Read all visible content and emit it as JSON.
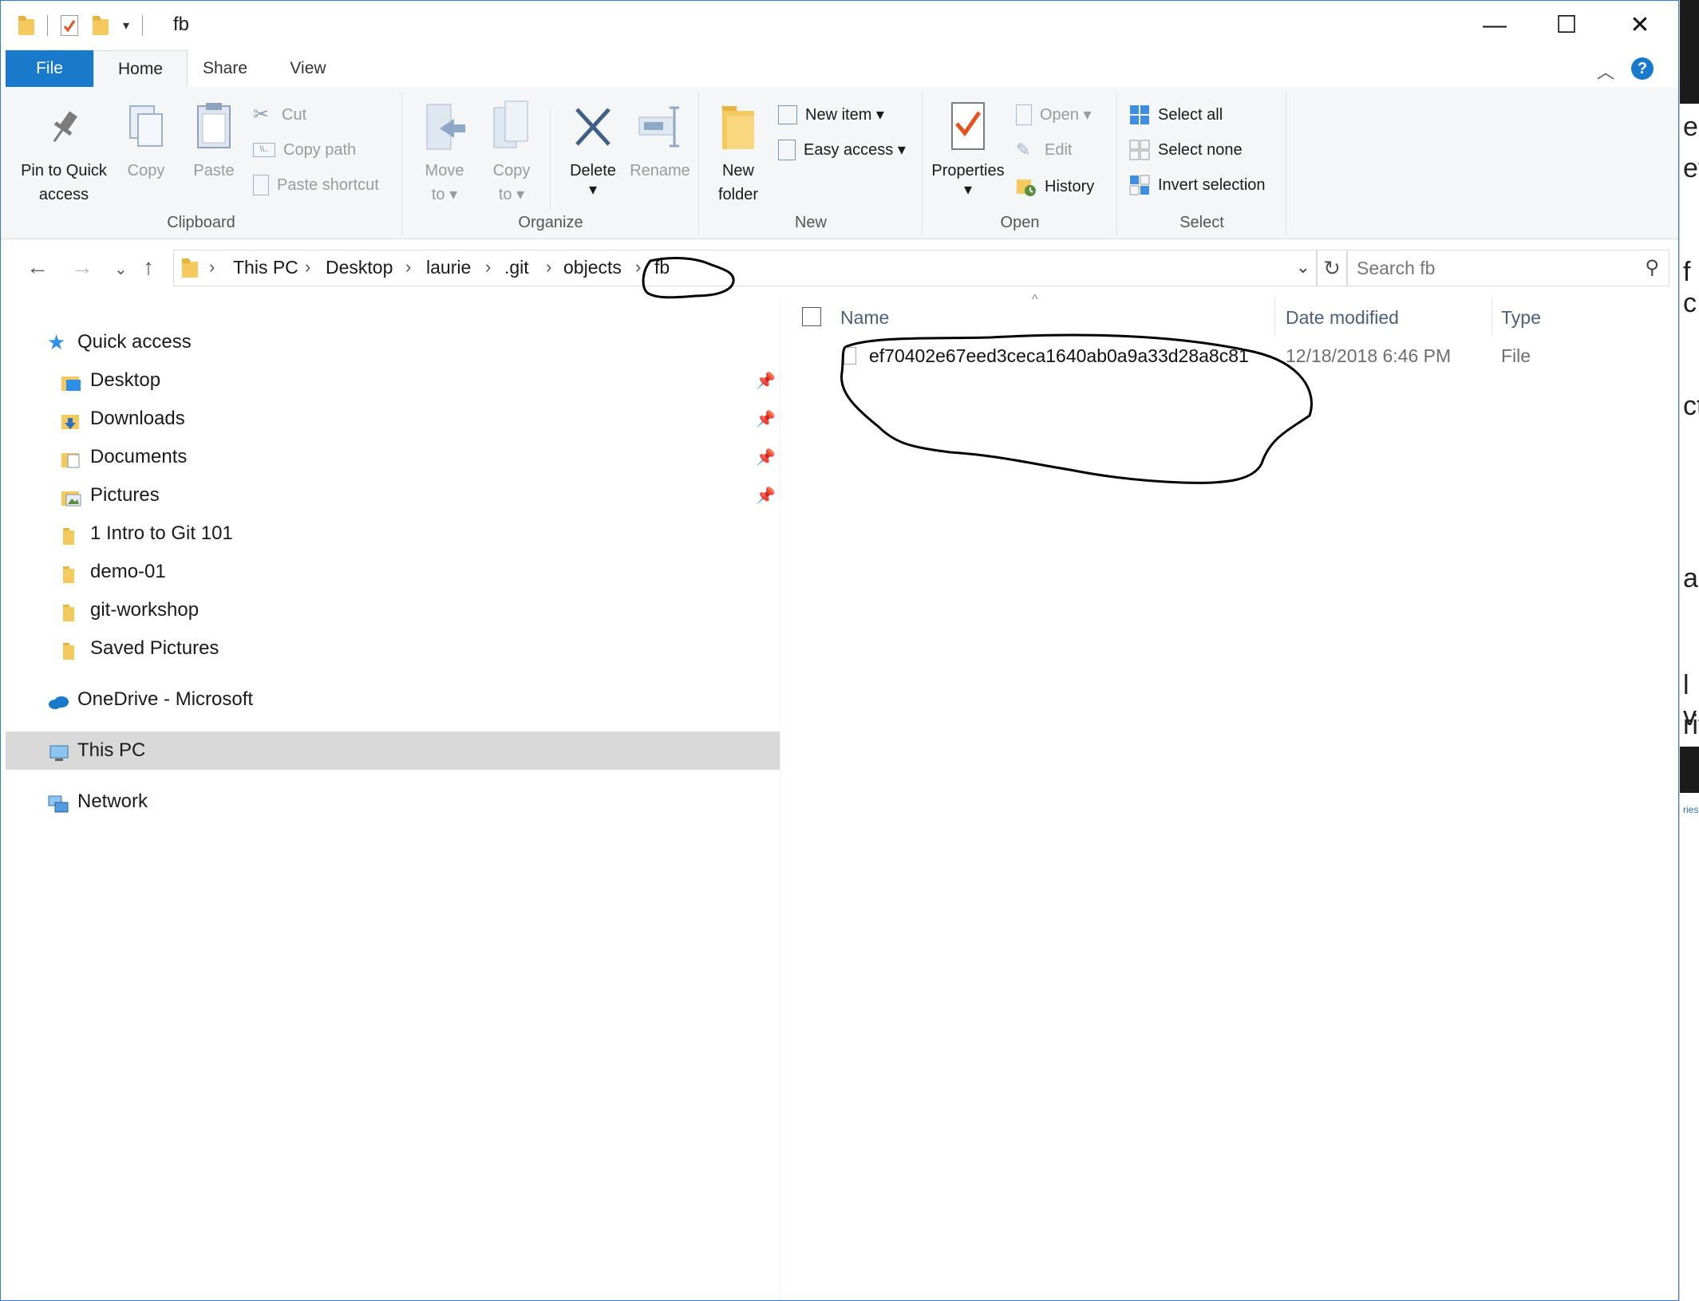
{
  "window": {
    "title": "fb",
    "controls": {
      "minimize": "—",
      "maximize": "☐",
      "close": "✕"
    }
  },
  "tabs": [
    {
      "label": "File"
    },
    {
      "label": "Home"
    },
    {
      "label": "Share"
    },
    {
      "label": "View"
    }
  ],
  "ribbon": {
    "clipboard": {
      "label": "Clipboard",
      "pin_line1": "Pin to Quick",
      "pin_line2": "access",
      "copy": "Copy",
      "paste": "Paste",
      "cut": "Cut",
      "copy_path": "Copy path",
      "paste_shortcut": "Paste shortcut"
    },
    "organize": {
      "label": "Organize",
      "move_line1": "Move",
      "move_line2": "to ▾",
      "copyto_line1": "Copy",
      "copyto_line2": "to ▾",
      "delete": "Delete",
      "delete_arrow": "▾",
      "rename": "Rename"
    },
    "new": {
      "label": "New",
      "new_folder_line1": "New",
      "new_folder_line2": "folder",
      "new_item": "New item ▾",
      "easy_access": "Easy access ▾"
    },
    "open": {
      "label": "Open",
      "properties": "Properties",
      "properties_arrow": "▾",
      "open": "Open ▾",
      "edit": "Edit",
      "history": "History"
    },
    "select": {
      "label": "Select",
      "select_all": "Select all",
      "select_none": "Select none",
      "invert_selection": "Invert selection"
    }
  },
  "address": {
    "crumbs": [
      "This PC",
      "Desktop",
      "laurie",
      ".git",
      "objects",
      "fb"
    ],
    "search_placeholder": "Search fb"
  },
  "navpane": {
    "quick_access": "Quick access",
    "pinned": [
      "Desktop",
      "Downloads",
      "Documents",
      "Pictures"
    ],
    "folders": [
      "1 Intro to Git 101",
      "demo-01",
      "git-workshop",
      "Saved Pictures"
    ],
    "onedrive": "OneDrive - Microsoft",
    "this_pc": "This PC",
    "network": "Network"
  },
  "content": {
    "columns": {
      "name": "Name",
      "date": "Date modified",
      "type": "Type"
    },
    "rows": [
      {
        "name": "ef70402e67eed3ceca1640ab0a9a33d28a8c81",
        "date": "12/18/2018 6:46 PM",
        "type": "File"
      }
    ]
  },
  "background_window": {
    "fragments": [
      "ec",
      "et.",
      "f c",
      "ct",
      "ar",
      "l v",
      "riv",
      "ries"
    ]
  },
  "colors": {
    "accent": "#1979ca",
    "selection": "#d9d9d9",
    "folder": "#f4c95d"
  }
}
